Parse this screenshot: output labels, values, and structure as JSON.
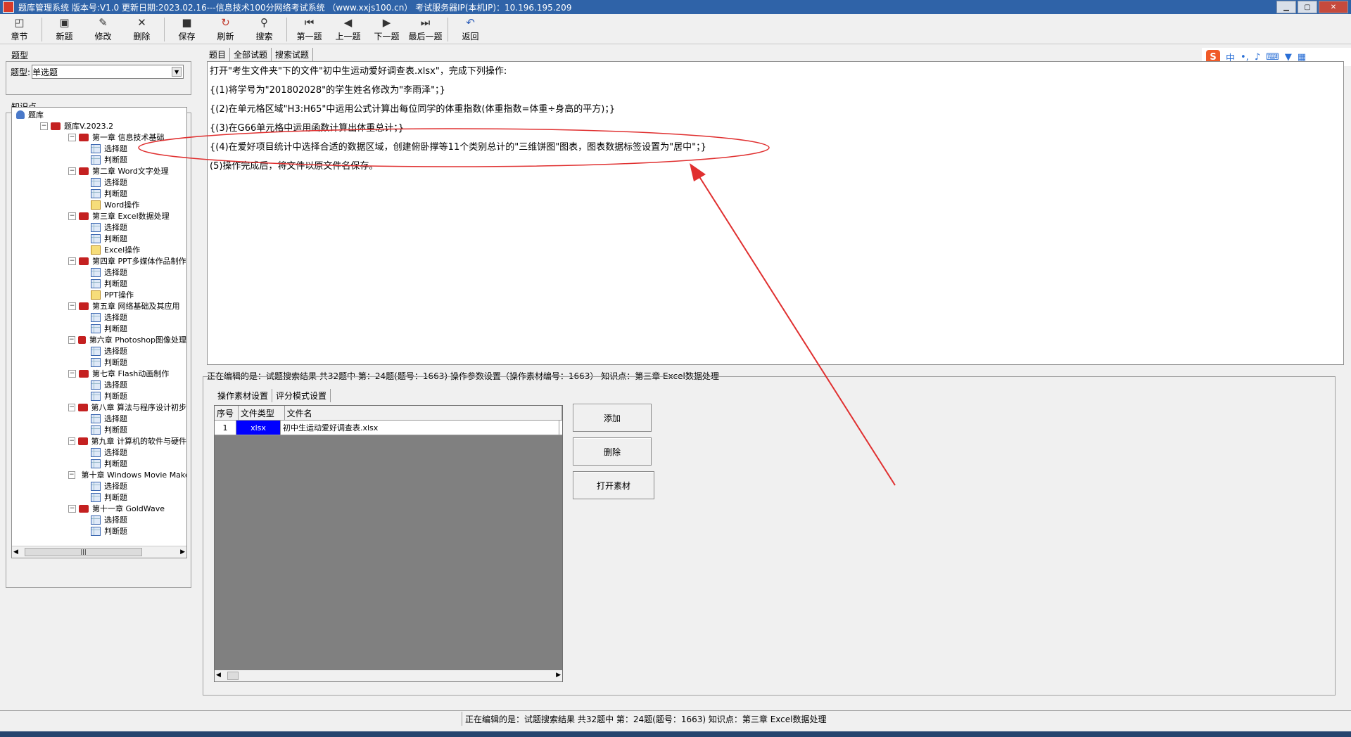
{
  "window": {
    "title": "题库管理系统 版本号:V1.0 更新日期:2023.02.16---信息技术100分网络考试系统 （www.xxjs100.cn） 考试服务器IP(本机IP)：10.196.195.209"
  },
  "toolbar": [
    {
      "id": "chapter",
      "label": "章节",
      "icon": "◰"
    },
    {
      "id": "new",
      "label": "新题",
      "icon": "▣"
    },
    {
      "id": "edit",
      "label": "修改",
      "icon": "✎"
    },
    {
      "id": "delete",
      "label": "删除",
      "icon": "✕"
    },
    {
      "id": "save",
      "label": "保存",
      "icon": "■"
    },
    {
      "id": "refresh",
      "label": "刷新",
      "icon": "↻"
    },
    {
      "id": "search",
      "label": "搜索",
      "icon": "⚲"
    },
    {
      "id": "first",
      "label": "第一题",
      "icon": "⏮"
    },
    {
      "id": "prev",
      "label": "上一题",
      "icon": "◀"
    },
    {
      "id": "next",
      "label": "下一题",
      "icon": "▶"
    },
    {
      "id": "last",
      "label": "最后一题",
      "icon": "⏭"
    },
    {
      "id": "back",
      "label": "返回",
      "icon": "↶"
    }
  ],
  "left": {
    "type_group_title": "题型",
    "type_label": "题型:",
    "type_value": "单选题",
    "knowledge_title": "知识点"
  },
  "tree": [
    {
      "level": 0,
      "icon": "root",
      "label": "题库"
    },
    {
      "level": 1,
      "icon": "book",
      "label": "题库V.2023.2",
      "exp": "−"
    },
    {
      "level": 2,
      "icon": "book",
      "label": "第一章 信息技术基础",
      "exp": "−"
    },
    {
      "level": 3,
      "icon": "grid",
      "label": "选择题"
    },
    {
      "level": 3,
      "icon": "grid",
      "label": "判断题"
    },
    {
      "level": 2,
      "icon": "book",
      "label": "第二章 Word文字处理",
      "exp": "−"
    },
    {
      "level": 3,
      "icon": "grid",
      "label": "选择题"
    },
    {
      "level": 3,
      "icon": "grid",
      "label": "判断题"
    },
    {
      "level": 3,
      "icon": "op",
      "label": "Word操作"
    },
    {
      "level": 2,
      "icon": "book",
      "label": "第三章 Excel数据处理",
      "exp": "−"
    },
    {
      "level": 3,
      "icon": "grid",
      "label": "选择题"
    },
    {
      "level": 3,
      "icon": "grid",
      "label": "判断题"
    },
    {
      "level": 3,
      "icon": "op",
      "label": "Excel操作"
    },
    {
      "level": 2,
      "icon": "book",
      "label": "第四章 PPT多媒体作品制作",
      "exp": "−"
    },
    {
      "level": 3,
      "icon": "grid",
      "label": "选择题"
    },
    {
      "level": 3,
      "icon": "grid",
      "label": "判断题"
    },
    {
      "level": 3,
      "icon": "op",
      "label": "PPT操作"
    },
    {
      "level": 2,
      "icon": "book",
      "label": "第五章 网络基础及其应用",
      "exp": "−"
    },
    {
      "level": 3,
      "icon": "grid",
      "label": "选择题"
    },
    {
      "level": 3,
      "icon": "grid",
      "label": "判断题"
    },
    {
      "level": 2,
      "icon": "book",
      "label": "第六章 Photoshop图像处理",
      "exp": "−"
    },
    {
      "level": 3,
      "icon": "grid",
      "label": "选择题"
    },
    {
      "level": 3,
      "icon": "grid",
      "label": "判断题"
    },
    {
      "level": 2,
      "icon": "book",
      "label": "第七章 Flash动画制作",
      "exp": "−"
    },
    {
      "level": 3,
      "icon": "grid",
      "label": "选择题"
    },
    {
      "level": 3,
      "icon": "grid",
      "label": "判断题"
    },
    {
      "level": 2,
      "icon": "book",
      "label": "第八章 算法与程序设计初步",
      "exp": "−"
    },
    {
      "level": 3,
      "icon": "grid",
      "label": "选择题"
    },
    {
      "level": 3,
      "icon": "grid",
      "label": "判断题"
    },
    {
      "level": 2,
      "icon": "book",
      "label": "第九章 计算机的软件与硬件",
      "exp": "−"
    },
    {
      "level": 3,
      "icon": "grid",
      "label": "选择题"
    },
    {
      "level": 3,
      "icon": "grid",
      "label": "判断题"
    },
    {
      "level": 2,
      "icon": "book",
      "label": "第十章 Windows Movie Maker",
      "exp": "−"
    },
    {
      "level": 3,
      "icon": "grid",
      "label": "选择题"
    },
    {
      "level": 3,
      "icon": "grid",
      "label": "判断题"
    },
    {
      "level": 2,
      "icon": "book",
      "label": "第十一章 GoldWave",
      "exp": "−"
    },
    {
      "level": 3,
      "icon": "grid",
      "label": "选择题"
    },
    {
      "level": 3,
      "icon": "grid",
      "label": "判断题"
    }
  ],
  "tabs_top": [
    "题目",
    "全部试题",
    "搜索试题"
  ],
  "question": [
    "打开\"考生文件夹\"下的文件\"初中生运动爱好调查表.xlsx\"，完成下列操作:",
    "{(1)将学号为\"201802028\"的学生姓名修改为\"李雨泽\"；}",
    "{(2)在单元格区域\"H3:H65\"中运用公式计算出每位同学的体重指数(体重指数=体重÷身高的平方)；}",
    "{(3)在G66单元格中运用函数计算出体重总计；}",
    "{(4)在爱好项目统计中选择合适的数据区域，创建俯卧撑等11个类别总计的\"三维饼图\"图表，图表数据标签设置为\"居中\"；}",
    "(5)操作完成后，将文件以原文件名保存。"
  ],
  "editing_status": "正在编辑的是：试题搜索结果 共32题中  第：24题(题号：1663) 操作参数设置（操作素材编号：1663） 知识点：第三章 Excel数据处理",
  "tabs_bottom": [
    "操作素材设置",
    "评分模式设置"
  ],
  "grid": {
    "headers": [
      "序号",
      "文件类型",
      "文件名"
    ],
    "rows": [
      [
        "1",
        "xlsx",
        "初中生运动爱好调查表.xlsx"
      ]
    ]
  },
  "buttons": {
    "add": "添加",
    "delete": "删除",
    "open": "打开素材"
  },
  "statusbar": "正在编辑的是：试题搜索结果 共32题中  第：24题(题号：1663)  知识点：第三章 Excel数据处理",
  "ime": {
    "logo": "S",
    "lang": "中"
  },
  "colors": {
    "annotation": "#e03030",
    "title_bar": "#2f63a8",
    "file_type_cell": "#0000ff"
  }
}
